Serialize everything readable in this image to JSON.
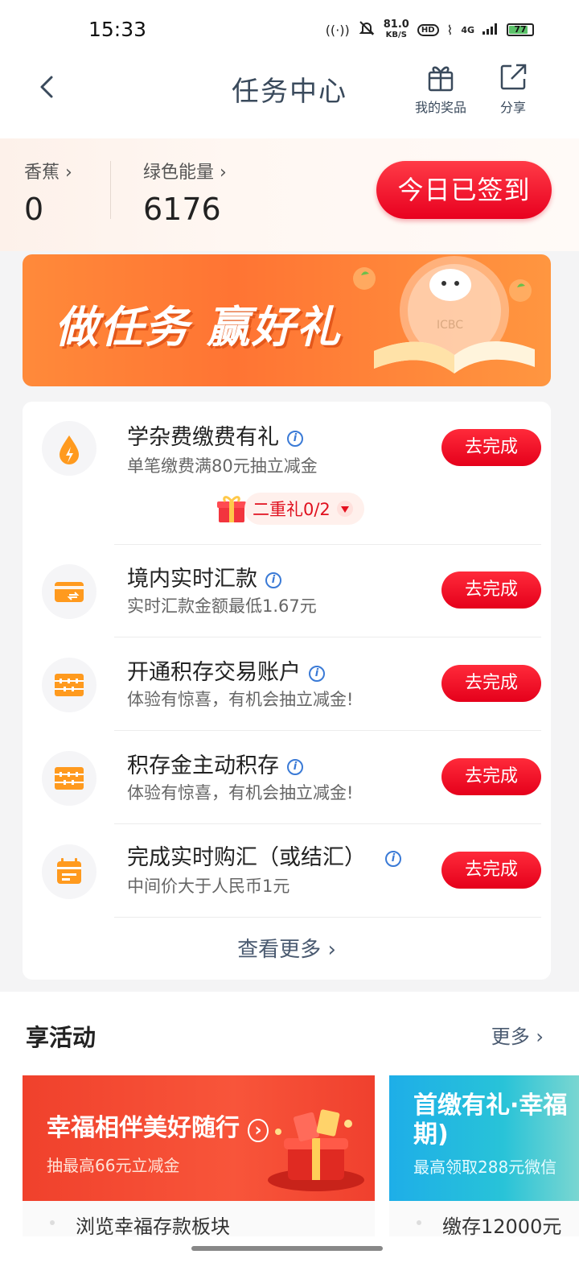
{
  "status_bar": {
    "time": "15:33",
    "net_speed": "81.0",
    "net_unit": "KB/S",
    "hd": "HD",
    "signal": "4G",
    "battery": "77"
  },
  "header": {
    "title": "任务中心",
    "my_prizes_label": "我的奖品",
    "share_label": "分享"
  },
  "stats": {
    "banana_label": "香蕉",
    "banana_value": "0",
    "energy_label": "绿色能量",
    "energy_value": "6176",
    "checkin_label": "今日已签到"
  },
  "banner": {
    "text": "做任务 赢好礼",
    "logo_text": "ICBC"
  },
  "tasks": [
    {
      "title": "学杂费缴费有礼",
      "desc": "单笔缴费满80元抽立减金",
      "button": "去完成",
      "icon": "water-drop-icon"
    },
    {
      "title": "境内实时汇款",
      "desc": "实时汇款金额最低1.67元",
      "button": "去完成",
      "icon": "card-transfer-icon"
    },
    {
      "title": "开通积存交易账户",
      "desc": "体验有惊喜，有机会抽立减金!",
      "button": "去完成",
      "icon": "abacus-icon"
    },
    {
      "title": "积存金主动积存",
      "desc": "体验有惊喜，有机会抽立减金!",
      "button": "去完成",
      "icon": "abacus-icon"
    },
    {
      "title": "完成实时购汇（或结汇）",
      "desc": "中间价大于人民币1元",
      "button": "去完成",
      "icon": "calendar-icon"
    }
  ],
  "bonus": {
    "label": "二重礼0/2"
  },
  "see_more": "查看更多",
  "activities": {
    "title": "享活动",
    "more": "更多",
    "cards": [
      {
        "headline": "幸福相伴美好随行",
        "sub": "抽最高66元立减金",
        "footer": "浏览幸福存款板块"
      },
      {
        "headline": "首缴有礼·幸福期)",
        "sub": "最高领取288元微信",
        "footer": "缴存12000元"
      }
    ]
  },
  "colors": {
    "accent_red": "#e5001b",
    "banner_orange": "#ff7433",
    "title_slate": "#3a4a5c"
  }
}
